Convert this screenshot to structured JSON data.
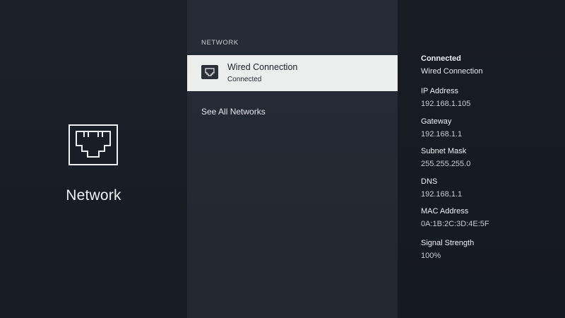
{
  "left": {
    "title": "Network",
    "icon": "ethernet-port-icon"
  },
  "middle": {
    "section_header": "NETWORK",
    "connections": [
      {
        "title": "Wired Connection",
        "status": "Connected",
        "icon": "ethernet-port-icon"
      }
    ],
    "see_all_label": "See All Networks"
  },
  "details": {
    "connected": {
      "label": "Connected",
      "value": "Wired Connection"
    },
    "ip": {
      "label": "IP Address",
      "value": "192.168.1.105"
    },
    "gateway": {
      "label": "Gateway",
      "value": "192.168.1.1"
    },
    "subnet": {
      "label": "Subnet Mask",
      "value": "255.255.255.0"
    },
    "dns": {
      "label": "DNS",
      "value": "192.168.1.1"
    },
    "mac": {
      "label": "MAC Address",
      "value": "0A:1B:2C:3D:4E:5F"
    },
    "signal": {
      "label": "Signal Strength",
      "value": "100%"
    }
  },
  "colors": {
    "background": "#1a1f27",
    "middle_panel": "#262c36",
    "selected_item": "#eceded",
    "text_primary": "#eef0f3"
  }
}
